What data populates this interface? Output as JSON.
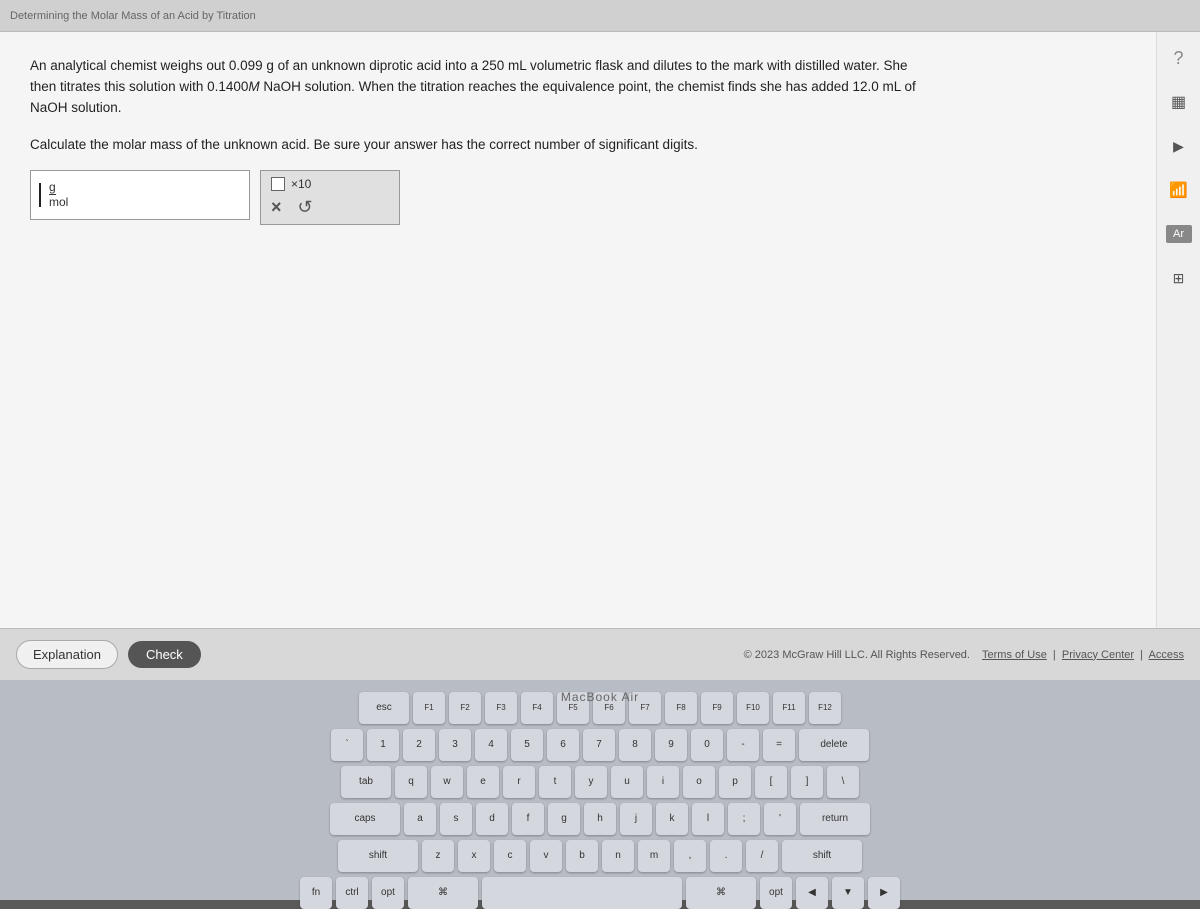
{
  "window": {
    "title": "Determining the Molar Mass of an Acid by Titration"
  },
  "question": {
    "paragraph": "An analytical chemist weighs out 0.099 g of an unknown diprotic acid into a 250 mL volumetric flask and dilutes to the mark with distilled water. She then titrates this solution with 0.1400 M NaOH solution. When the titration reaches the equivalence point, the chemist finds she has added 12.0 mL of NaOH solution.",
    "prompt": "Calculate the molar mass of the unknown acid. Be sure your answer has the correct number of significant digits.",
    "unit_numerator": "g",
    "unit_denominator": "mol"
  },
  "sci_notation": {
    "label": "×10",
    "btn_x": "×",
    "btn_undo": "↺"
  },
  "buttons": {
    "explanation": "Explanation",
    "check": "Check"
  },
  "copyright": {
    "text": "© 2023 McGraw Hill LLC. All Rights Reserved.",
    "terms": "Terms of Use",
    "privacy": "Privacy Center",
    "access": "Access"
  },
  "sidebar": {
    "icons": [
      {
        "name": "question-mark-icon",
        "symbol": "?",
        "interactable": true
      },
      {
        "name": "calculator-icon",
        "symbol": "⊞",
        "interactable": true
      },
      {
        "name": "play-icon",
        "symbol": "▶",
        "interactable": true
      },
      {
        "name": "chart-icon",
        "symbol": "📊",
        "interactable": true
      },
      {
        "name": "ar-icon",
        "symbol": "Ar",
        "interactable": true
      },
      {
        "name": "grid-icon",
        "symbol": "⊟",
        "interactable": true
      }
    ]
  },
  "keyboard": {
    "brand": "MacBook Air",
    "rows": [
      [
        "esc",
        "F1",
        "F2",
        "F3",
        "F4",
        "F5",
        "F6",
        "F7",
        "F8",
        "F9",
        "F10",
        "F11",
        "F12"
      ],
      [
        "`",
        "1",
        "2",
        "3",
        "4",
        "5",
        "6",
        "7",
        "8",
        "9",
        "0",
        "-",
        "=",
        "delete"
      ],
      [
        "tab",
        "q",
        "w",
        "e",
        "r",
        "t",
        "y",
        "u",
        "i",
        "o",
        "p",
        "[",
        "]",
        "\\"
      ],
      [
        "caps",
        "a",
        "s",
        "d",
        "f",
        "g",
        "h",
        "j",
        "k",
        "l",
        ";",
        "'",
        "return"
      ],
      [
        "shift",
        "z",
        "x",
        "c",
        "v",
        "b",
        "n",
        "m",
        ",",
        ".",
        "/",
        "shift"
      ],
      [
        "fn",
        "ctrl",
        "opt",
        "cmd",
        "space",
        "cmd",
        "opt",
        "◀",
        "▼",
        "▶"
      ]
    ]
  }
}
